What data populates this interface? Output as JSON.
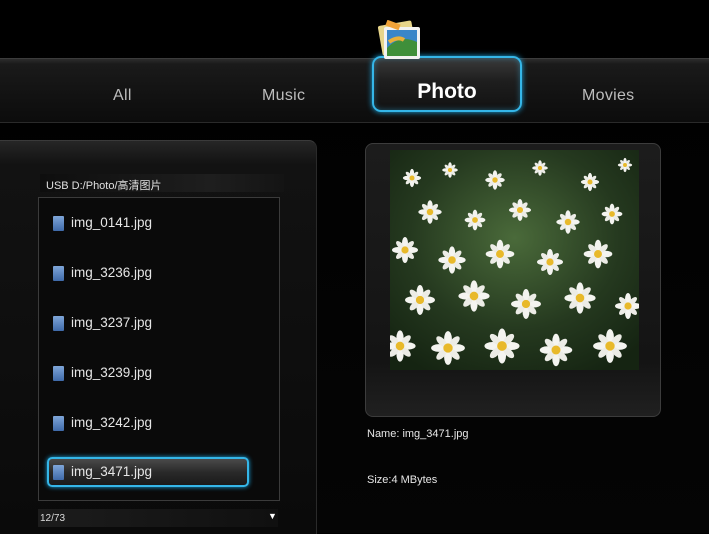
{
  "tabs": {
    "all": "All",
    "music": "Music",
    "photo": "Photo",
    "movies": "Movies"
  },
  "browser": {
    "path": "USB D:/Photo/高清图片",
    "files": [
      {
        "name": "img_0141.jpg"
      },
      {
        "name": "img_3236.jpg"
      },
      {
        "name": "img_3237.jpg"
      },
      {
        "name": "img_3239.jpg"
      },
      {
        "name": "img_3242.jpg"
      },
      {
        "name": "img_3471.jpg"
      }
    ],
    "selected_index": 5,
    "count": "12/73",
    "scroll_icon": "triangle-down-icon"
  },
  "preview": {
    "name_label": "Name: img_3471.jpg",
    "size_label": "Size:4 MBytes"
  },
  "colors": {
    "highlight": "#35b6e8",
    "background": "#000000",
    "text": "#e6e6e6"
  }
}
